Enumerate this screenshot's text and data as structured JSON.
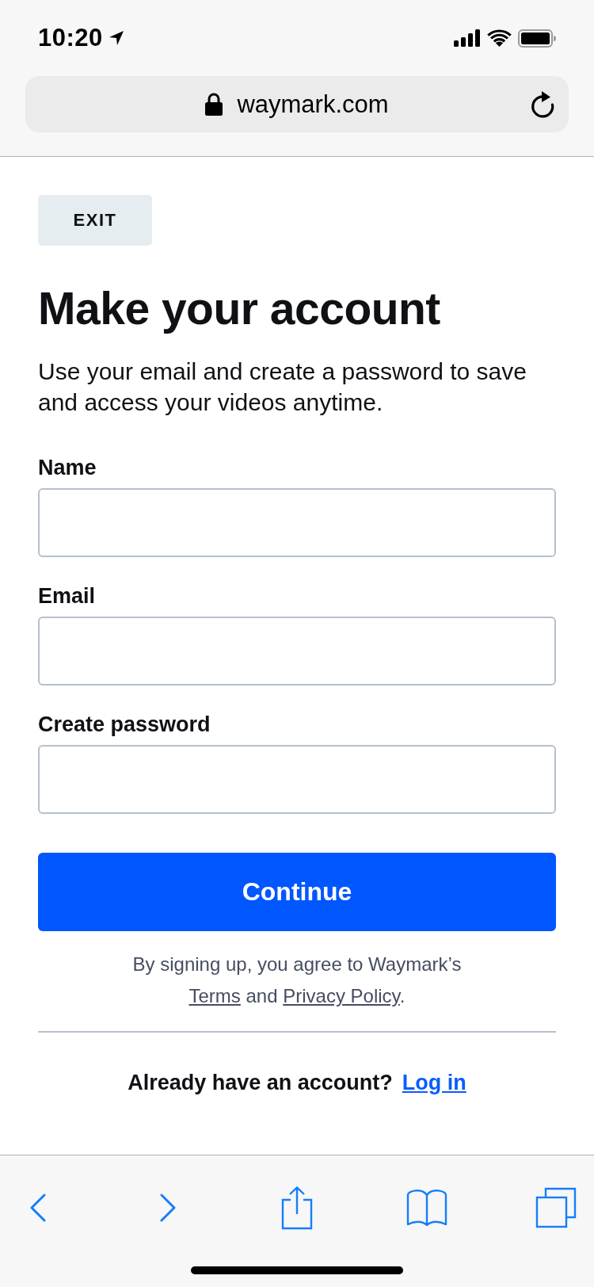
{
  "status_bar": {
    "time": "10:20"
  },
  "address_bar": {
    "url": "waymark.com"
  },
  "exit_button": {
    "label": "EXIT"
  },
  "title": "Make your account",
  "description": "Use your email and create a password to save and access your videos anytime.",
  "fields": [
    {
      "label": "Name"
    },
    {
      "label": "Email"
    },
    {
      "label": "Create password"
    }
  ],
  "submit_button": {
    "label": "Continue"
  },
  "legal": {
    "intro": "By signing up, you agree to Waymark’s",
    "terms_link": "Terms",
    "joiner": "and",
    "privacy_link": "Privacy Policy",
    "end": "."
  },
  "login": {
    "prompt": "Already have an account?",
    "link": "Log in"
  }
}
